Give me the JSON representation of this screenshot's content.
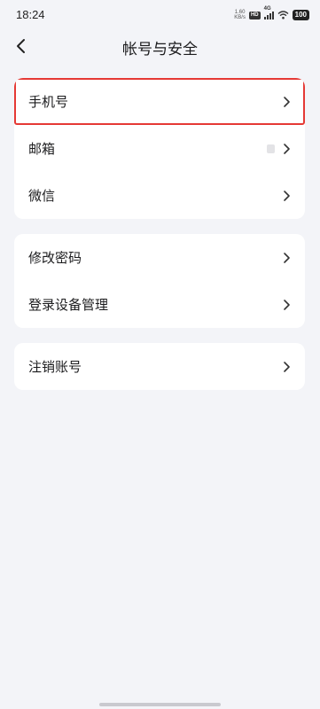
{
  "status_bar": {
    "time": "18:24",
    "net_speed": [
      "1.60",
      "KB/s"
    ],
    "hd": "HD",
    "network": "4G",
    "battery": "100"
  },
  "nav": {
    "title": "帐号与安全",
    "back_icon": "chevron-left-icon"
  },
  "sections": [
    {
      "items": [
        {
          "label": "手机号",
          "highlighted": true
        },
        {
          "label": "邮箱"
        },
        {
          "label": "微信"
        }
      ]
    },
    {
      "items": [
        {
          "label": "修改密码"
        },
        {
          "label": "登录设备管理"
        }
      ]
    },
    {
      "items": [
        {
          "label": "注销账号"
        }
      ]
    }
  ],
  "colors": {
    "background": "#f3f4f8",
    "card": "#ffffff",
    "highlight_border": "#e53935",
    "text": "#1c1c1e"
  }
}
